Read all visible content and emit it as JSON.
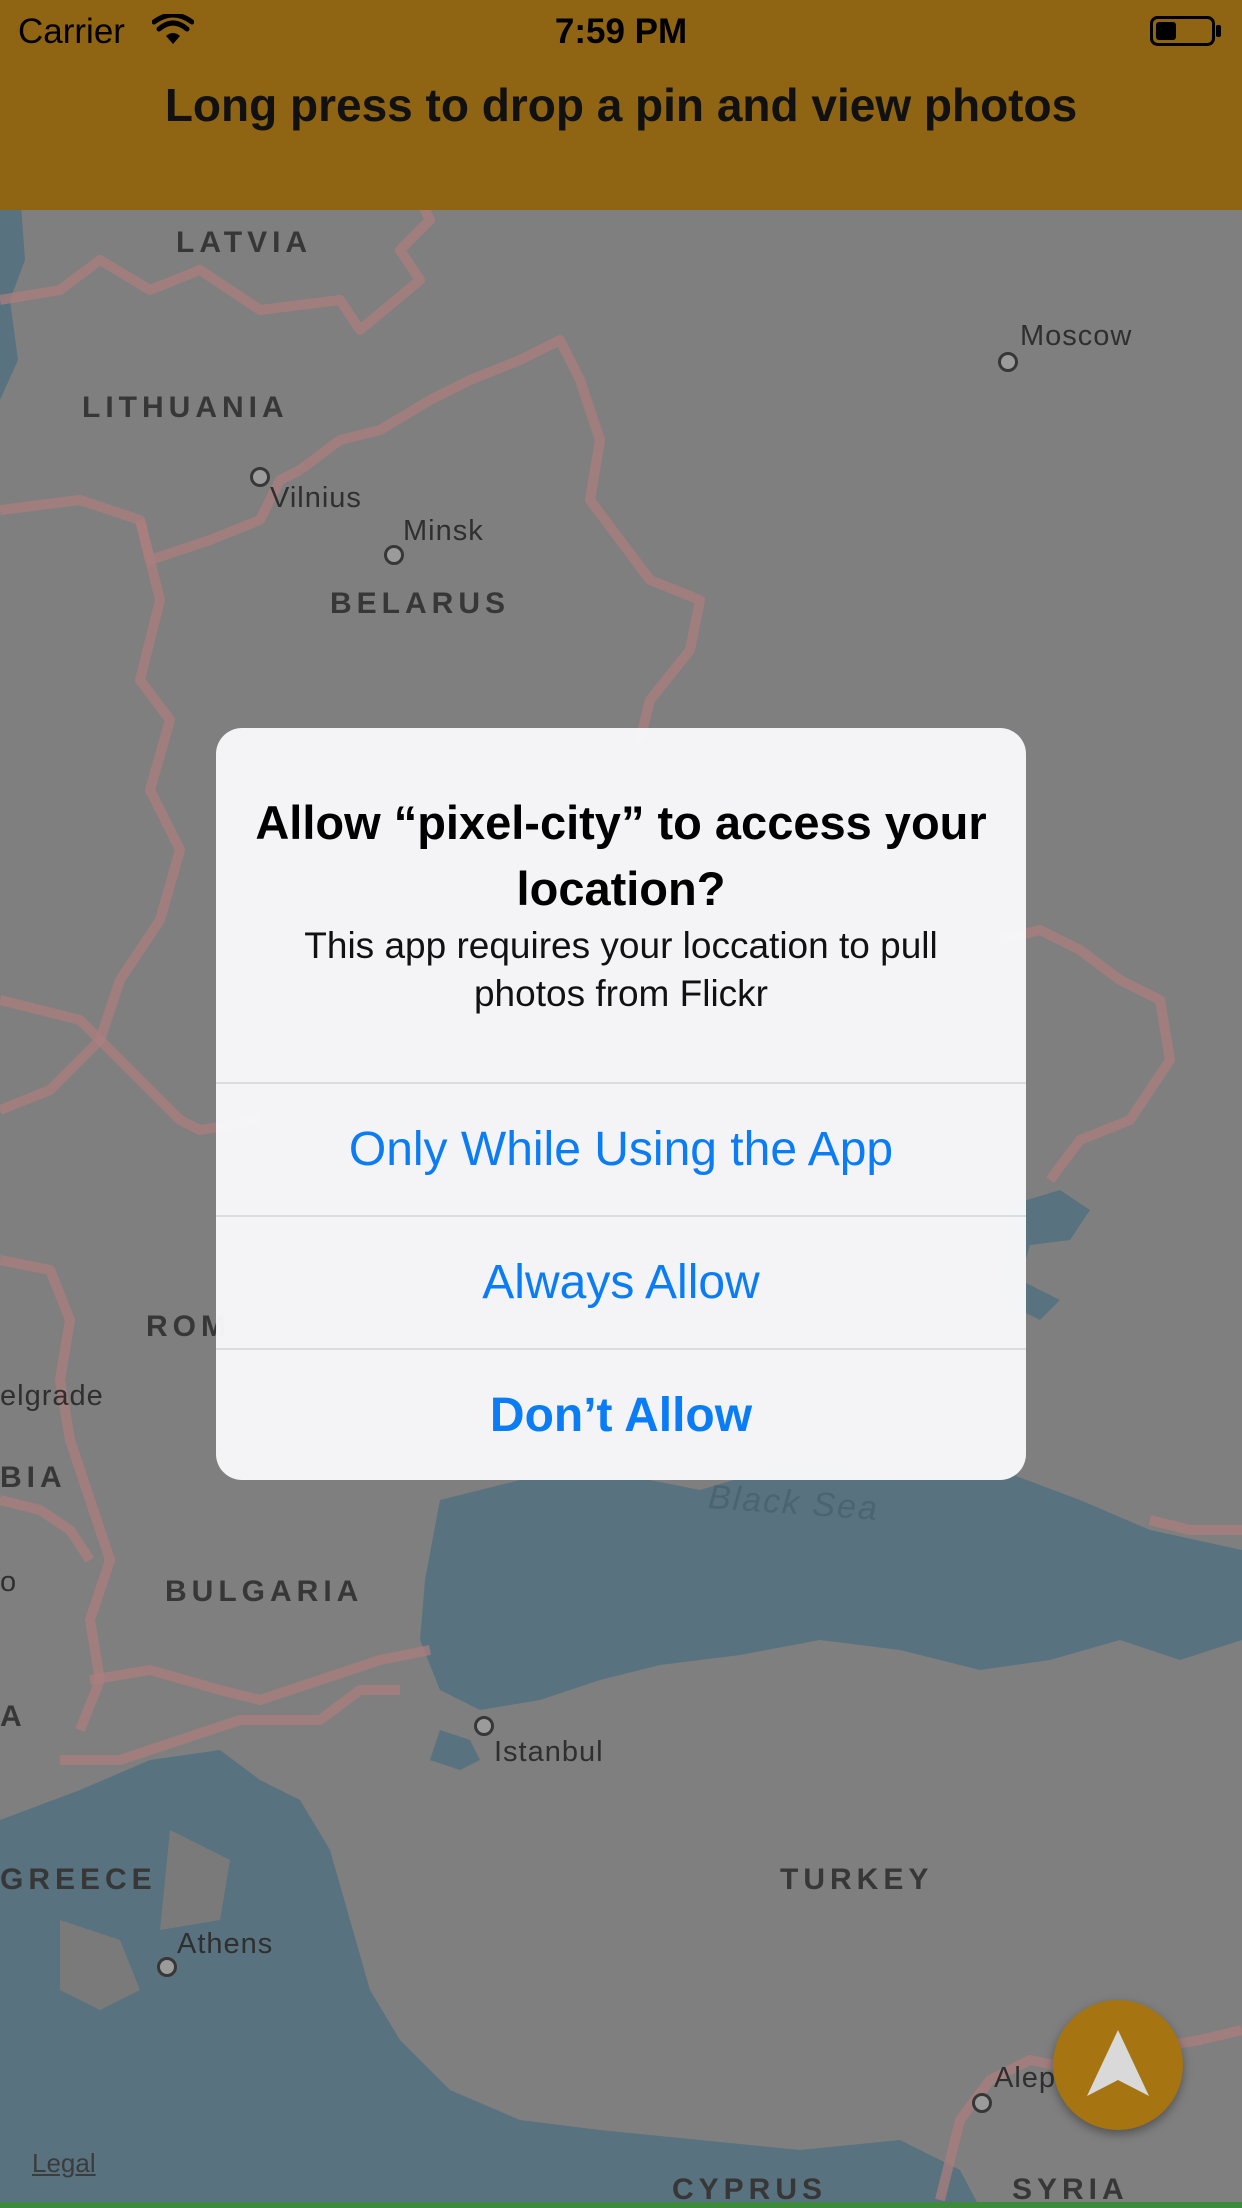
{
  "status_bar": {
    "carrier": "Carrier",
    "time": "7:59 PM"
  },
  "header": {
    "title": "Long press to drop a pin and view photos"
  },
  "map": {
    "countries": [
      "LATVIA",
      "LITHUANIA",
      "BELARUS",
      "ROM",
      "BIA",
      "BULGARIA",
      "A",
      "GREECE",
      "TURKEY",
      "CYPRUS",
      "SYRIA"
    ],
    "cities": [
      "Moscow",
      "Vilnius",
      "Minsk",
      "elgrade",
      "Istanbul",
      "Athens",
      "Alep",
      "o"
    ],
    "seas": [
      "Black Sea"
    ],
    "legal": "Legal"
  },
  "alert": {
    "title": "Allow “pixel-city” to access your location?",
    "message": "This app requires your loccation to pull photos from Flickr",
    "buttons": [
      "Only While Using the App",
      "Always Allow",
      "Don’t Allow"
    ]
  },
  "colors": {
    "header": "#8f6412",
    "accent": "#0a7cf6",
    "locate_button": "#a67512"
  },
  "icons": {
    "locate": "navigation-arrow-icon",
    "wifi": "wifi-icon",
    "battery": "battery-icon"
  }
}
